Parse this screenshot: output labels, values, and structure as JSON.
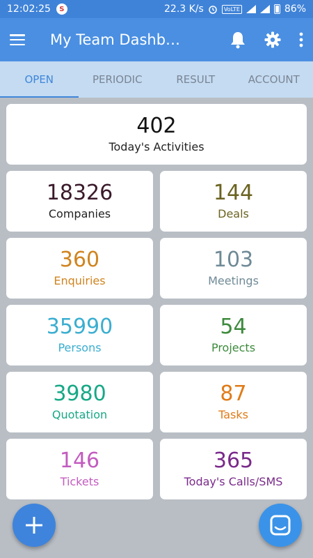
{
  "status_bar": {
    "time": "12:02:25",
    "speed": "22.3 K/s",
    "network": "VoLTE",
    "battery": "86%"
  },
  "app_bar": {
    "title": "My Team Dashbo...",
    "icons": [
      "menu-icon",
      "bell-icon",
      "gear-icon",
      "more-vert-icon"
    ]
  },
  "tabs": [
    {
      "label": "OPEN",
      "active": true
    },
    {
      "label": "PERIODIC",
      "active": false
    },
    {
      "label": "RESULT",
      "active": false
    },
    {
      "label": "ACCOUNT",
      "active": false
    }
  ],
  "summary": {
    "value": "402",
    "label": "Today's Activities",
    "color": "#111111"
  },
  "tiles": [
    {
      "value": "18326",
      "label": "Companies",
      "color": "#3a1a2a",
      "label_color": "#222222"
    },
    {
      "value": "144",
      "label": "Deals",
      "color": "#6b6320",
      "label_color": "#6b6320"
    },
    {
      "value": "360",
      "label": "Enquiries",
      "color": "#d0841f",
      "label_color": "#d0841f"
    },
    {
      "value": "103",
      "label": "Meetings",
      "color": "#6f8a96",
      "label_color": "#6f8a96"
    },
    {
      "value": "35990",
      "label": "Persons",
      "color": "#3aaed0",
      "label_color": "#3aaed0"
    },
    {
      "value": "54",
      "label": "Projects",
      "color": "#3c8a3c",
      "label_color": "#3c8a3c"
    },
    {
      "value": "3980",
      "label": "Quotation",
      "color": "#16a886",
      "label_color": "#16a886"
    },
    {
      "value": "87",
      "label": "Tasks",
      "color": "#e07b17",
      "label_color": "#e07b17"
    },
    {
      "value": "146",
      "label": "Tickets",
      "color": "#c35cc0",
      "label_color": "#c35cc0"
    },
    {
      "value": "365",
      "label": "Today's Calls/SMS",
      "color": "#7a2a8a",
      "label_color": "#7a2a8a"
    }
  ],
  "fab": {
    "add_icon": "plus-icon",
    "chat_icon": "chat-icon"
  }
}
